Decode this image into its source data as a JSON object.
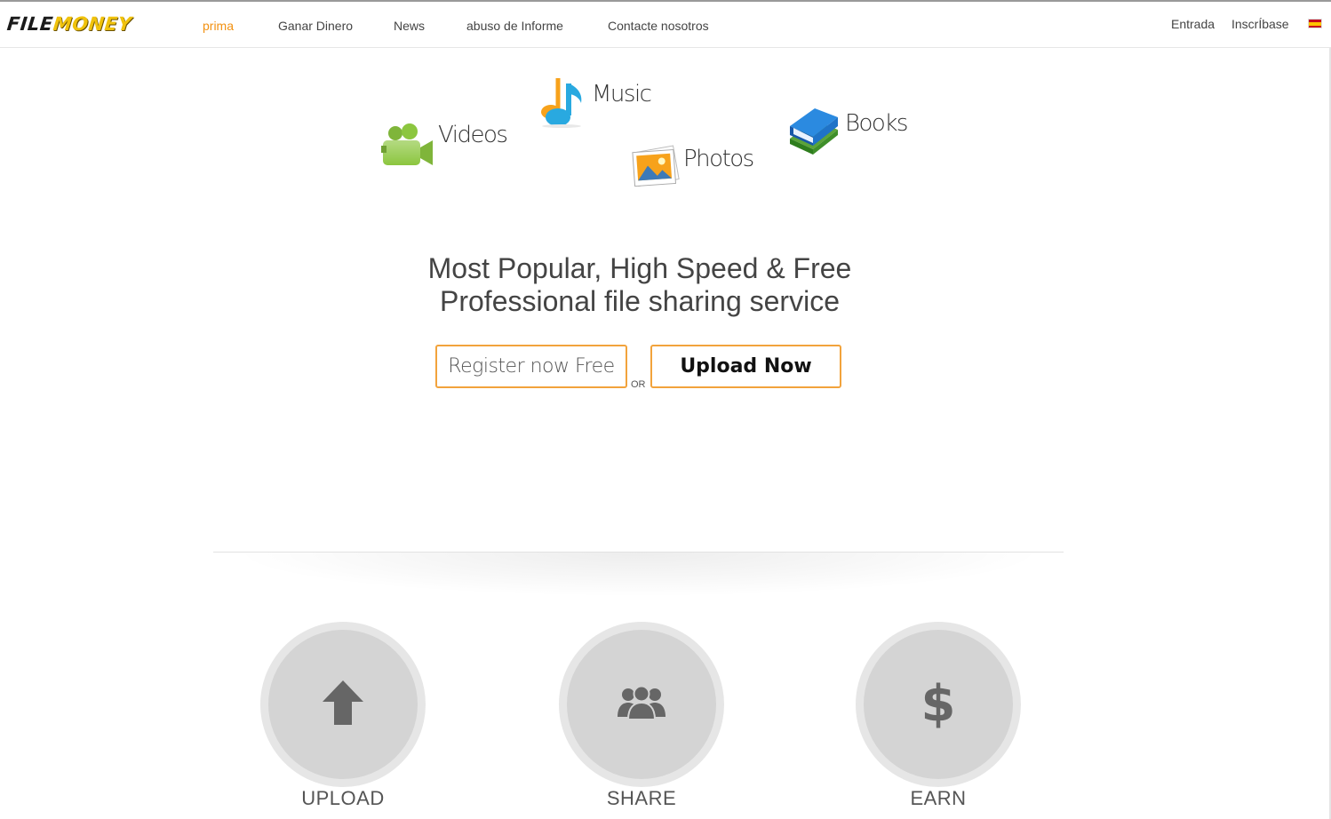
{
  "header": {
    "logo_part1": "FILE",
    "logo_part2": "MONEY",
    "nav": [
      {
        "label": "prima",
        "active": true
      },
      {
        "label": "Ganar Dinero",
        "active": false
      },
      {
        "label": "News",
        "active": false
      },
      {
        "label": "abuso de Informe",
        "active": false
      },
      {
        "label": "Contacte nosotros",
        "active": false
      }
    ],
    "login_label": "Entrada",
    "signup_label": "InscrÍbase",
    "language_flag": "spain-flag-icon"
  },
  "media_types": [
    {
      "label": "Videos",
      "icon": "video-camera-icon",
      "color": "#8cc63f"
    },
    {
      "label": "Music",
      "icon": "music-note-icon",
      "color": "#29a9e0"
    },
    {
      "label": "Photos",
      "icon": "photos-icon",
      "color": "#f7a21b"
    },
    {
      "label": "Books",
      "icon": "books-icon",
      "color": "#1f73c8"
    }
  ],
  "hero": {
    "line1": "Most Popular, High Speed & Free",
    "line2": "Professional file sharing service",
    "register_label": "Register now Free",
    "or_label": "OR",
    "upload_label": "Upload Now"
  },
  "steps": [
    {
      "label": "UPLOAD",
      "icon": "upload-arrow-icon"
    },
    {
      "label": "SHARE",
      "icon": "users-group-icon"
    },
    {
      "label": "EARN",
      "icon": "dollar-icon"
    }
  ],
  "colors": {
    "accent": "#f29111",
    "button_border": "#f2a33c",
    "logo_yellow": "#f0c20c",
    "circle_outer": "#e6e6e6",
    "circle_inner": "#d4d4d4"
  }
}
